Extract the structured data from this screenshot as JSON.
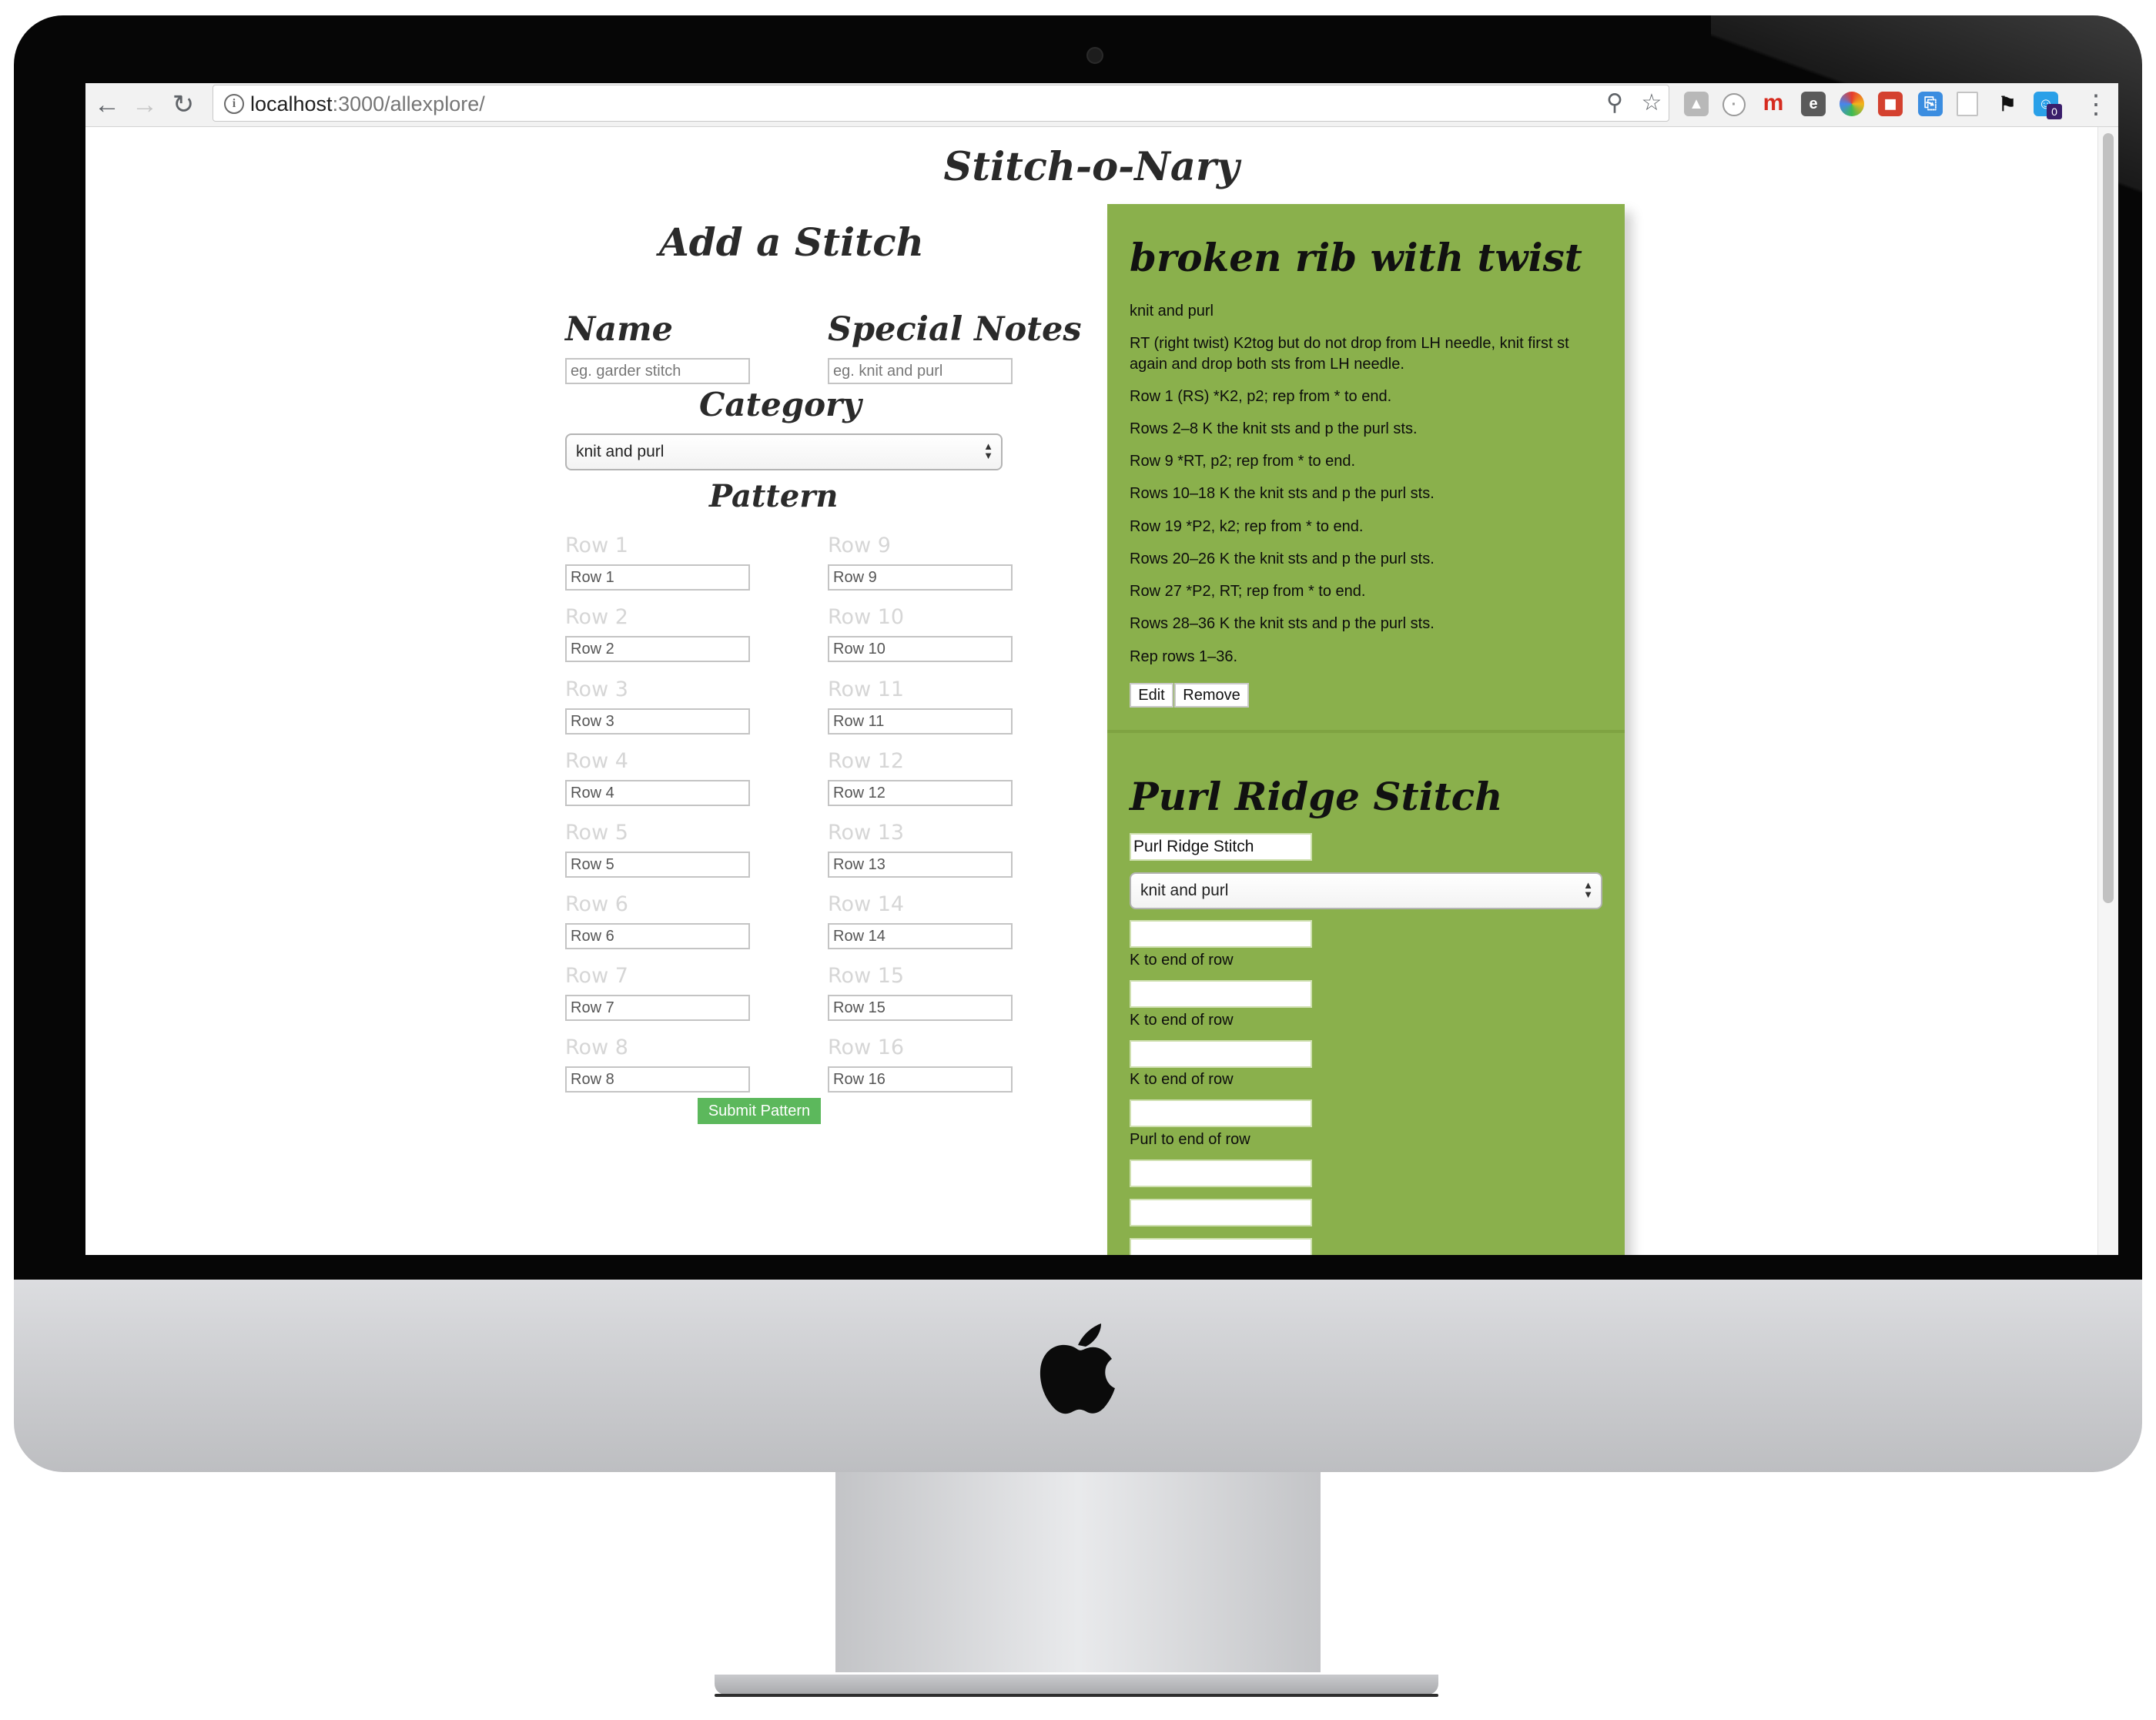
{
  "browser": {
    "url_host": "localhost",
    "url_path": ":3000/allexplore/",
    "extension_badge": "0"
  },
  "site": {
    "title": "Stitch-o-Nary"
  },
  "add_form": {
    "heading": "Add a Stitch",
    "name_label": "Name",
    "name_placeholder": "eg. garder stitch",
    "notes_label": "Special Notes",
    "notes_placeholder": "eg. knit and purl",
    "category_label": "Category",
    "category_value": "knit and purl",
    "pattern_label": "Pattern",
    "rows_left": [
      {
        "label": "Row 1",
        "placeholder": "Row 1"
      },
      {
        "label": "Row 2",
        "placeholder": "Row 2"
      },
      {
        "label": "Row 3",
        "placeholder": "Row 3"
      },
      {
        "label": "Row 4",
        "placeholder": "Row 4"
      },
      {
        "label": "Row 5",
        "placeholder": "Row 5"
      },
      {
        "label": "Row 6",
        "placeholder": "Row 6"
      },
      {
        "label": "Row 7",
        "placeholder": "Row 7"
      },
      {
        "label": "Row 8",
        "placeholder": "Row 8"
      }
    ],
    "rows_right": [
      {
        "label": "Row 9",
        "placeholder": "Row 9"
      },
      {
        "label": "Row 10",
        "placeholder": "Row 10"
      },
      {
        "label": "Row 11",
        "placeholder": "Row 11"
      },
      {
        "label": "Row 12",
        "placeholder": "Row 12"
      },
      {
        "label": "Row 13",
        "placeholder": "Row 13"
      },
      {
        "label": "Row 14",
        "placeholder": "Row 14"
      },
      {
        "label": "Row 15",
        "placeholder": "Row 15"
      },
      {
        "label": "Row 16",
        "placeholder": "Row 16"
      }
    ],
    "submit_label": "Submit Pattern"
  },
  "stitches": [
    {
      "name": "broken rib with twist",
      "category": "knit and purl",
      "notes_1": "RT (right twist) K2tog but do not drop from LH needle, knit first st",
      "notes_2": "again and drop both sts from LH needle.",
      "rows": [
        "Row 1 (RS) *K2, p2; rep from * to end.",
        "Rows 2–8 K the knit sts and p the purl sts.",
        "Row 9 *RT, p2; rep from * to end.",
        "Rows 10–18 K the knit sts and p the purl sts.",
        "Row 19 *P2, k2; rep from * to end.",
        "Rows 20–26 K the knit sts and p the purl sts.",
        "Row 27 *P2, RT; rep from * to end.",
        "Rows 28–36 K the knit sts and p the purl sts.",
        "Rep rows 1–36."
      ],
      "edit_label": "Edit",
      "remove_label": "Remove"
    },
    {
      "name": "Purl Ridge Stitch",
      "name_value": "Purl Ridge Stitch",
      "category_value": "knit and purl",
      "row_texts": [
        "K to end of row",
        "K to end of row",
        "K to end of row",
        "Purl to end of row"
      ]
    }
  ],
  "colors": {
    "panel_green": "#8ab04c",
    "submit_green": "#5cb85c"
  },
  "icons": [
    "back-icon",
    "forward-icon",
    "reload-icon",
    "info-icon",
    "zoom-icon",
    "star-icon",
    "menu-icon",
    "apple-logo"
  ]
}
